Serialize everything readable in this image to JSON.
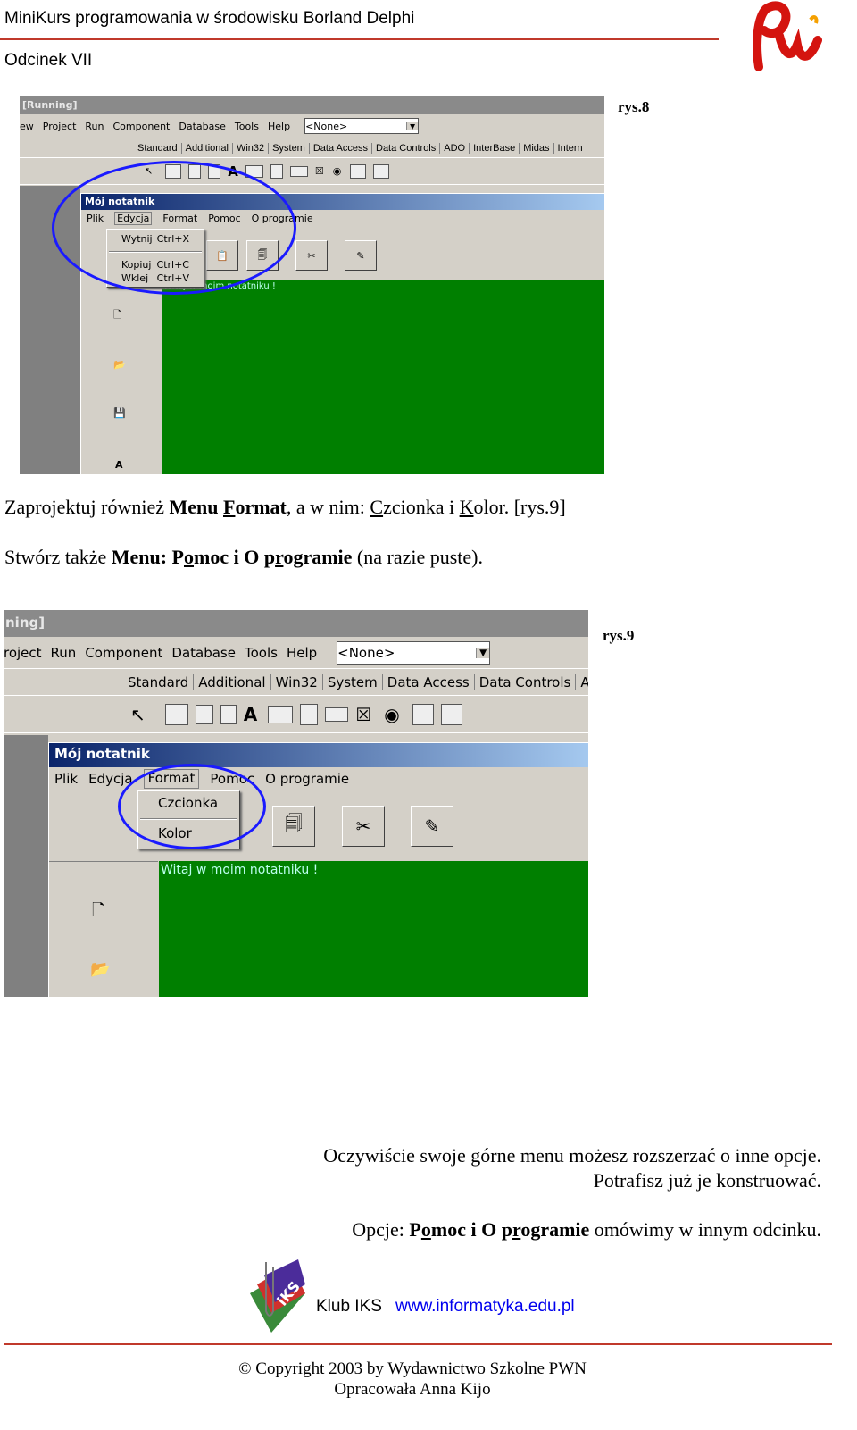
{
  "header": {
    "title": "MiniKurs programowania w środowisku Borland Delphi",
    "episode": "Odcinek VII",
    "logo": "PWN"
  },
  "fig8": {
    "caption": "rys.8",
    "ide_title": "[Running]",
    "ide_menu": [
      "ew",
      "Project",
      "Run",
      "Component",
      "Database",
      "Tools",
      "Help"
    ],
    "combo_value": "<None>",
    "palette_tabs": [
      "Standard",
      "Additional",
      "Win32",
      "System",
      "Data Access",
      "Data Controls",
      "ADO",
      "InterBase",
      "Midas",
      "Intern"
    ],
    "form_title": "Mój notatnik",
    "form_menu": [
      "Plik",
      "Edycja",
      "Format",
      "Pomoc",
      "O programie"
    ],
    "popup": [
      {
        "label": "Wytnij",
        "shortcut": "Ctrl+X"
      },
      {
        "label": "Kopiuj",
        "shortcut": "Ctrl+C"
      },
      {
        "label": "Wklej",
        "shortcut": "Ctrl+V"
      }
    ],
    "memo_text": "Witaj w moim notatniku !"
  },
  "para1": {
    "p1": "Zaprojektuj również ",
    "b1": "Menu ",
    "b1u": "F",
    "b1r": "ormat",
    "p2": ", a w nim: ",
    "u1": "C",
    "p3": "zcionka i ",
    "u2": "K",
    "p4": "olor. [rys.9]"
  },
  "para2": {
    "p1": "Stwórz także ",
    "b1": "Menu: P",
    "b1u": "o",
    "b1r": "moc i O p",
    "b2u": "r",
    "b2r": "ogramie",
    "p2": " (na razie puste)."
  },
  "fig9": {
    "caption": "rys.9",
    "ide_title": "ning]",
    "ide_menu": [
      "roject",
      "Run",
      "Component",
      "Database",
      "Tools",
      "Help"
    ],
    "combo_value": "<None>",
    "palette_tabs": [
      "Standard",
      "Additional",
      "Win32",
      "System",
      "Data Access",
      "Data Controls",
      "ADO"
    ],
    "form_title": "Mój notatnik",
    "form_menu": [
      "Plik",
      "Edycja",
      "Format",
      "Pomoc",
      "O programie"
    ],
    "popup": [
      "Czcionka",
      "Kolor"
    ],
    "memo_text": "Witaj w moim notatniku !"
  },
  "para3": {
    "line1": "Oczywiście swoje górne menu możesz rozszerzać o inne opcje.",
    "line2": "Potrafisz już je konstruować."
  },
  "para4": {
    "p1": "Opcje: ",
    "b1": "P",
    "b1u": "o",
    "b1r": "moc i O p",
    "b2u": "r",
    "b2r": "ogramie",
    "p2": " omówimy w innym odcinku."
  },
  "footer": {
    "logo": "iKS",
    "club": "Klub IKS",
    "url": "www.informatyka.edu.pl",
    "copyright": "© Copyright 2003 by Wydawnictwo Szkolne PWN",
    "author": "Opracowała Anna Kijo"
  },
  "colors": {
    "accent_line": "#c0392b",
    "highlight_oval": "#1a1aff",
    "memo_bg": "#007f00"
  }
}
